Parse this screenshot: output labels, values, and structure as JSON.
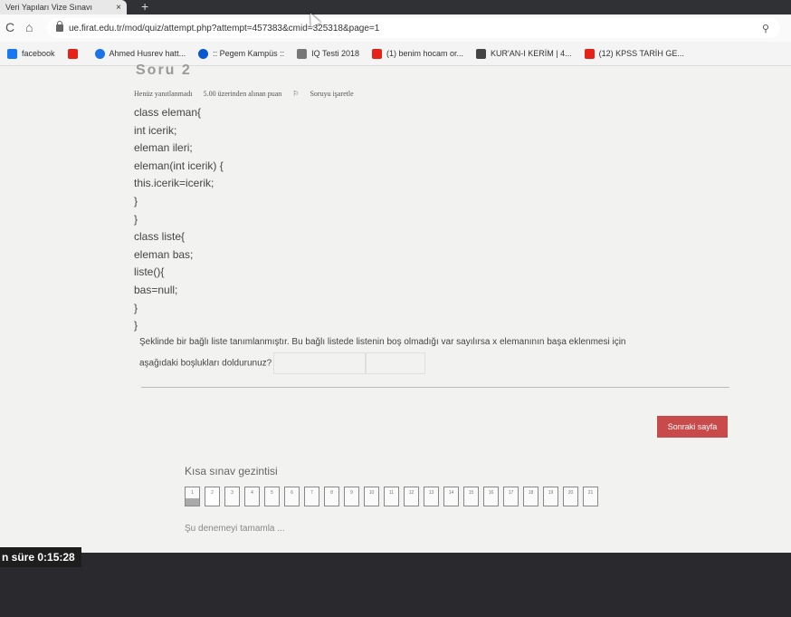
{
  "tab": {
    "title": "Veri Yapıları Vize Sınavı",
    "close": "×",
    "new": "+"
  },
  "toolbar": {
    "reload": "C",
    "home": "⌂",
    "url": "ue.firat.edu.tr/mod/quiz/attempt.php?attempt=457383&cmid=325318&page=1",
    "zoom_icon": "magnifier-icon"
  },
  "bookmarks": [
    {
      "label": "facebook",
      "color": "#1877f2"
    },
    {
      "label": "",
      "color": "#e62117"
    },
    {
      "label": "Ahmed Husrev hatt...",
      "color": "#1a73e8"
    },
    {
      "label": ":: Pegem Kampüs ::",
      "color": "#0b57d0"
    },
    {
      "label": "IQ Testi 2018",
      "color": "#777777"
    },
    {
      "label": "(1) benim hocam or...",
      "color": "#e62117"
    },
    {
      "label": "KUR'AN-I KERİM | 4...",
      "color": "#444444"
    },
    {
      "label": "(12) KPSS TARİH GE...",
      "color": "#e62117"
    }
  ],
  "question": {
    "header_faded": "Soru 2",
    "status": "Henüz yanıtlanmadı",
    "points": "5.00 üzerinden alınan puan",
    "flag": "Soruyu işaretle",
    "code": [
      "class eleman{",
      "int icerik;",
      "eleman ileri;",
      "eleman(int icerik) {",
      "this.icerik=icerik;",
      "}",
      "}",
      "class liste{",
      "eleman bas;",
      "liste(){",
      "bas=null;",
      "}",
      "}"
    ],
    "text1": "Şeklinde bir bağlı liste tanımlanmıştır. Bu bağlı listede listenin boş olmadığı var sayılırsa x elemanının başa eklenmesi için",
    "text2": "aşağıdaki boşlukları doldurunuz?"
  },
  "next_button": "Sonraki sayfa",
  "quiz_nav": {
    "title": "Kısa sınav gezintisi",
    "numbers": [
      "1",
      "2",
      "3",
      "4",
      "5",
      "6",
      "7",
      "8",
      "9",
      "10",
      "11",
      "12",
      "13",
      "14",
      "15",
      "16",
      "17",
      "18",
      "19",
      "20",
      "21"
    ],
    "finish": "Şu denemeyi tamamla ..."
  },
  "timer": "n süre 0:15:28"
}
